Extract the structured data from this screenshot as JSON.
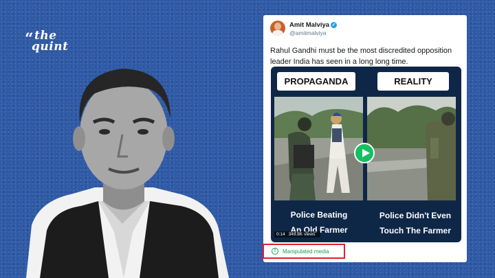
{
  "brand": {
    "line1": "the",
    "line2": "quint",
    "quote_mark": "“"
  },
  "tweet": {
    "author_name": "Amit Malviya",
    "author_handle": "@amitmalviya",
    "verified_glyph": "✓",
    "text": "Rahul Gandhi must be the most discredited opposition leader India has seen in a long long time."
  },
  "video": {
    "left_label": "PROPAGANDA",
    "right_label": "REALITY",
    "left_caption_line1": "Police Beating",
    "left_caption_line2": "An Old Farmer",
    "right_caption_line1": "Police Didn't Even",
    "right_caption_line2": "Touch The Farmer",
    "timestamp": "0:14",
    "views": "349.8K views"
  },
  "label": {
    "text": "Manipulated media",
    "icon_glyph": "!",
    "icon": "exclamation-circle-icon",
    "color": "#17a050",
    "border_color": "#e41d2d"
  },
  "colors": {
    "background": "#2f5aa6",
    "video_bg": "#0f2747",
    "play": "#17bf63"
  }
}
